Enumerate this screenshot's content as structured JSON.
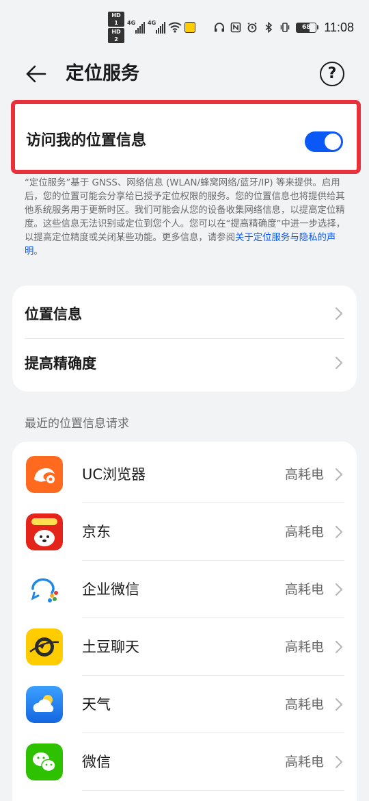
{
  "status_bar": {
    "sim1": "HD 1",
    "sim2": "HD 2",
    "net1": "4G",
    "net2": "4G",
    "battery": "68",
    "time": "11:08"
  },
  "header": {
    "title": "定位服务",
    "help_label": "?"
  },
  "location_access": {
    "label": "访问我的位置信息",
    "enabled": true
  },
  "description": {
    "text": "“定位服务”基于 GNSS、网络信息 (WLAN/蜂窝网络/蓝牙/IP) 等来提供。启用后，您的位置可能会分享给已授予定位权限的服务。您的位置信息也将提供给其他系统服务用于更新时区。我们可能会从您的设备收集网络信息，以提高定位精度。这些信息无法识别或定位到您个人。您可以在“提高精确度”中进一步选择，以提高定位精度或关闭某些功能。更多信息，请参阅",
    "link": "关于定位服务与隐私的声明",
    "suffix": "。"
  },
  "settings": [
    {
      "label": "位置信息"
    },
    {
      "label": "提高精确度"
    }
  ],
  "recent_requests": {
    "title": "最近的位置信息请求",
    "apps": [
      {
        "name": "UC浏览器",
        "status": "高耗电",
        "icon": "uc-browser-icon",
        "color": "#ff6a1f"
      },
      {
        "name": "京东",
        "status": "高耗电",
        "icon": "jd-icon",
        "color": "#e4231a"
      },
      {
        "name": "企业微信",
        "status": "高耗电",
        "icon": "wecom-icon",
        "color": "#1e88e5"
      },
      {
        "name": "土豆聊天",
        "status": "高耗电",
        "icon": "tudou-chat-icon",
        "color": "#ffcc00"
      },
      {
        "name": "天气",
        "status": "高耗电",
        "icon": "weather-icon",
        "color": "#1e90ff"
      },
      {
        "name": "微信",
        "status": "高耗电",
        "icon": "wechat-icon",
        "color": "#2dc100"
      }
    ]
  },
  "colors": {
    "accent": "#0a59f7",
    "highlight": "#e8313a",
    "background": "#f1f3f5"
  }
}
